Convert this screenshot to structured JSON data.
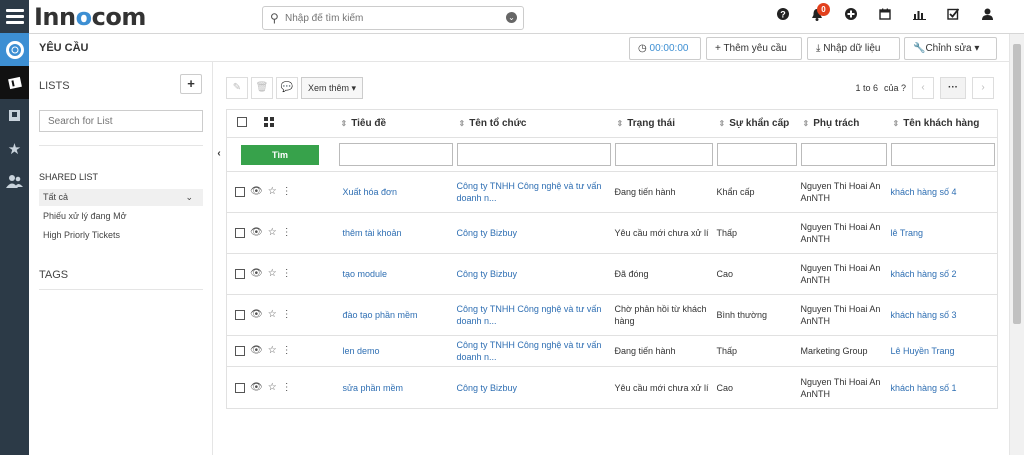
{
  "app": {
    "logo_prefix": "Inn",
    "logo_o": "o",
    "logo_suffix": "com"
  },
  "search": {
    "placeholder": "Nhập để tìm kiếm"
  },
  "notifications": {
    "count": "0"
  },
  "page": {
    "title": "YÊU CẦU",
    "timer": "00:00:00",
    "add_request": "Thêm yêu cầu",
    "import_data": "Nhập dữ liệu",
    "edit": "Chỉnh sửa"
  },
  "sidebar": {
    "lists_heading": "LISTS",
    "add_label": "+",
    "search_placeholder": "Search for List",
    "shared_heading": "SHARED LIST",
    "items": [
      {
        "label": "Tất cả"
      },
      {
        "label": "Phiếu xử lý đang Mở"
      },
      {
        "label": "High Priorly Tickets"
      }
    ],
    "tags_heading": "TAGS"
  },
  "toolbar": {
    "more_label": "Xem thêm ▾"
  },
  "pager": {
    "range": "1 to 6",
    "of_label": "của ?"
  },
  "table": {
    "find_label": "Tìm",
    "columns": [
      "Tiêu đề",
      "Tên tổ chức",
      "Trạng thái",
      "Sự khẩn cấp",
      "Phụ trách",
      "Tên khách hàng"
    ],
    "rows": [
      {
        "title": "Xuất hóa đơn",
        "org": "Công ty TNHH Công nghệ và tư vấn doanh n...",
        "status": "Đang tiến hành",
        "urgency": "Khẩn cấp",
        "owner": "Nguyen Thi Hoai An AnNTH",
        "customer": "khách hàng số 4"
      },
      {
        "title": "thêm tài khoản",
        "org": "Công ty Bizbuy",
        "status": "Yêu cầu mới chưa xử lí",
        "urgency": "Thấp",
        "owner": "Nguyen Thi Hoai An AnNTH",
        "customer": "lê Trang"
      },
      {
        "title": "tạo module",
        "org": "Công ty Bizbuy",
        "status": "Đã đóng",
        "urgency": "Cao",
        "owner": "Nguyen Thi Hoai An AnNTH",
        "customer": "khách hàng số 2"
      },
      {
        "title": "đào tạo phần mềm",
        "org": "Công ty TNHH Công nghệ và tư vấn doanh n...",
        "status": "Chờ phản hồi từ khách hàng",
        "urgency": "Bình thường",
        "owner": "Nguyen Thi Hoai An AnNTH",
        "customer": "khách hàng số 3"
      },
      {
        "title": "len demo",
        "org": "Công ty TNHH Công nghệ và tư vấn doanh n...",
        "status": "Đang tiến hành",
        "urgency": "Thấp",
        "owner": "Marketing Group",
        "customer": "Lê Huyền Trang"
      },
      {
        "title": "sửa phần mềm",
        "org": "Công ty Bizbuy",
        "status": "Yêu cầu mới chưa xử lí",
        "urgency": "Cao",
        "owner": "Nguyen Thi Hoai An AnNTH",
        "customer": "khách hàng số 1"
      }
    ]
  },
  "colors": {
    "accent": "#3d8fd3",
    "find_button": "#37a24b",
    "link": "#2f6fb3",
    "badge": "#e2401d",
    "rail": "#2c3a47"
  }
}
